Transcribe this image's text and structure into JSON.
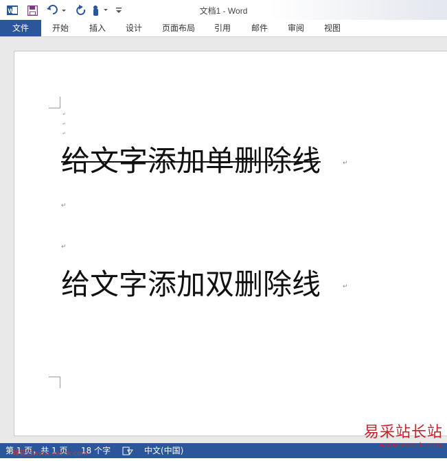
{
  "app": {
    "window_title": "文档1 - Word",
    "file_tab": "文件",
    "tabs": [
      "开始",
      "插入",
      "设计",
      "页面布局",
      "引用",
      "邮件",
      "审阅",
      "视图"
    ],
    "qat_icons": [
      "word-logo-icon",
      "save-icon",
      "undo-icon",
      "redo-icon",
      "touch-mode-icon",
      "customize-qat-icon"
    ]
  },
  "document": {
    "line1": "给文字添加单删除线",
    "line2": "给文字添加双删除线",
    "paragraph_mark": "↵"
  },
  "status": {
    "page": "第 1 页，共 1 页",
    "words": "18 个字",
    "language": "中文(中国)"
  },
  "watermark": {
    "title": "易采站长站",
    "url": "www.easck.com",
    "left_text": "转载自www.easck.com"
  },
  "colors": {
    "accent": "#2b579a",
    "watermark": "#c8202a"
  }
}
